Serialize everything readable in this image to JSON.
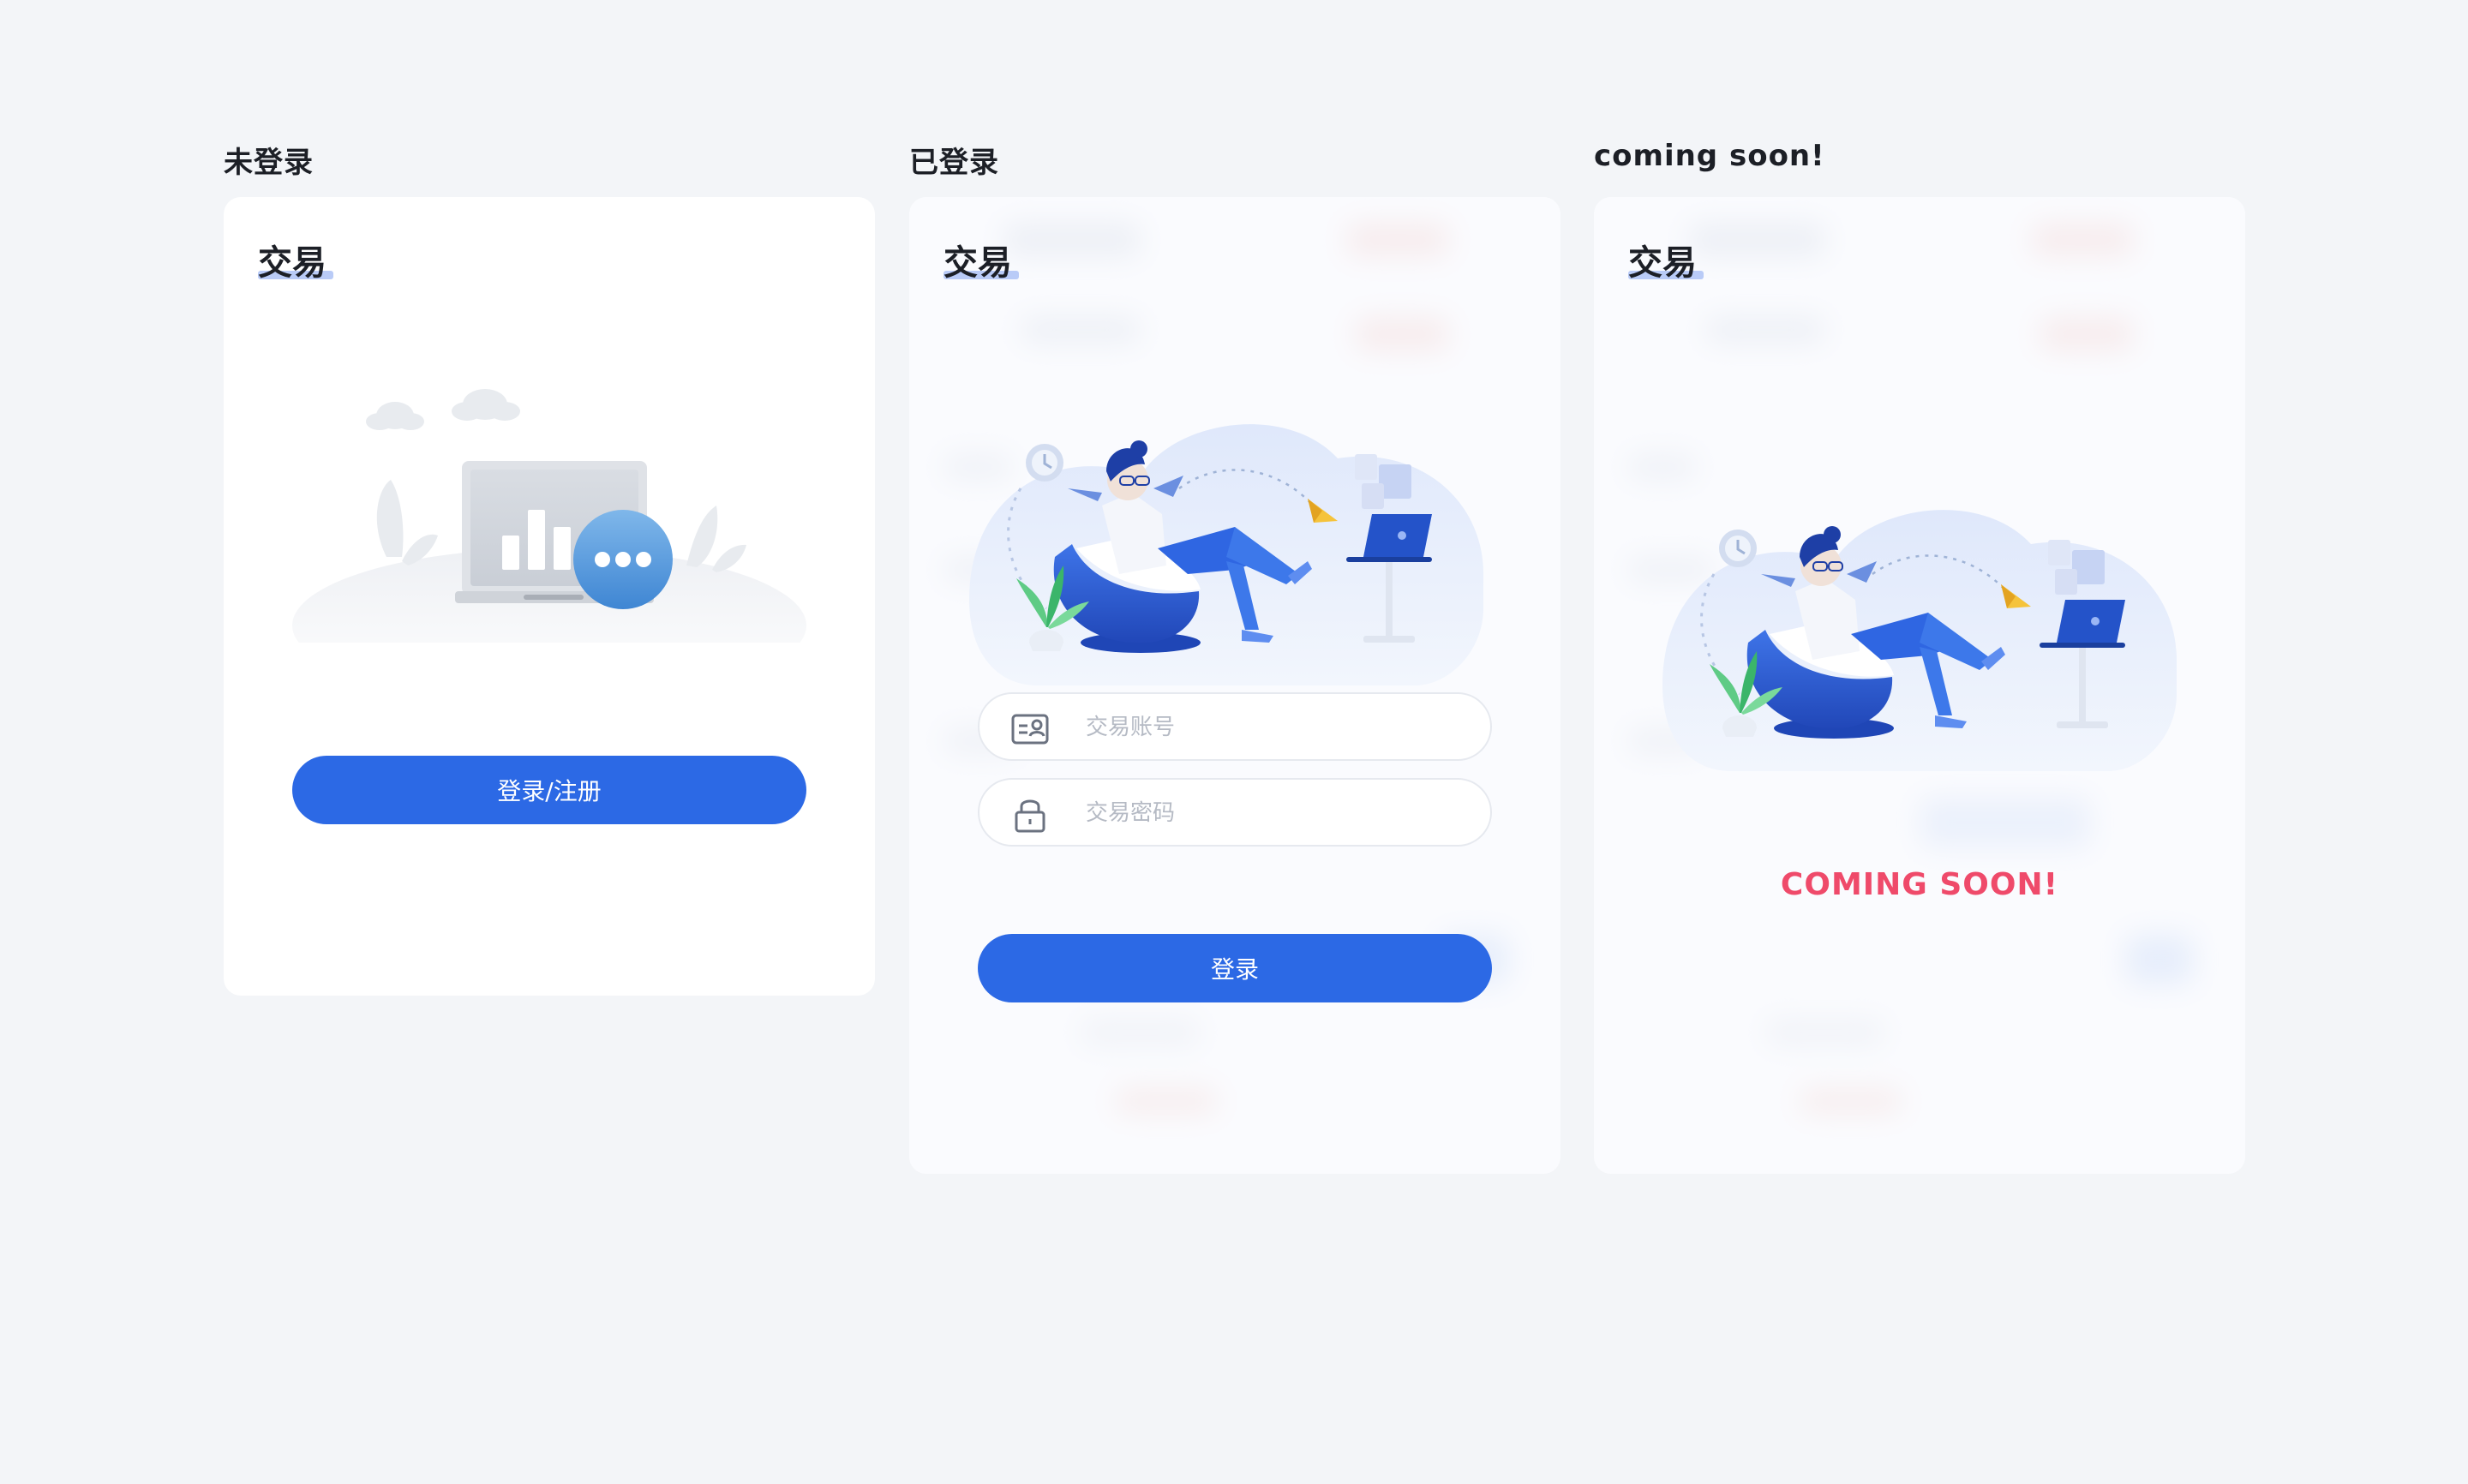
{
  "panels": [
    {
      "label": "未登录",
      "card_title": "交易",
      "login_register_button": "登录/注册"
    },
    {
      "label": "已登录",
      "card_title": "交易",
      "account_placeholder": "交易账号",
      "password_placeholder": "交易密码",
      "login_button": "登录"
    },
    {
      "label": "coming soon!",
      "card_title": "交易",
      "coming_soon_text": "COMING SOON!"
    }
  ],
  "icons": {
    "account": "account-card-icon",
    "password": "lock-icon"
  },
  "colors": {
    "page_background": "#f3f5f8",
    "primary_button": "#2c69e5",
    "title_underline": "#b9cbf7",
    "coming_soon": "#ef4a6a"
  }
}
